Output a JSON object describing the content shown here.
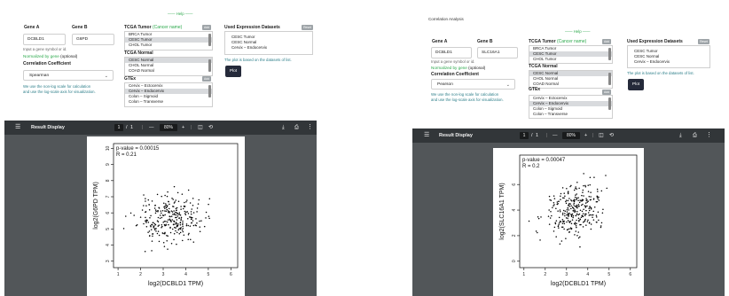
{
  "panels": [
    {
      "analysis_title": "",
      "help": "—— Help ——",
      "gene_a_label": "Gene A",
      "gene_b_label": "Gene B",
      "gene_a": "DCBLD1",
      "gene_b": "G6PD",
      "input_hint": "Input a gene symbol or id.",
      "norm_green": "Normalized by gene",
      "norm_rest": " (optional)",
      "coef_label": "Correlation Coefficient",
      "coef_value": "Spearman",
      "log_note_1": "We use the non-log scale for calculation",
      "log_note_2": "and use the log-scale axis for visualization.",
      "tumor_label": "TCGA Tumor",
      "tumor_green": " (Cancer name)",
      "tumor_items": [
        "BRCA Tumor",
        "CESC Tumor",
        "CHOL Tumor"
      ],
      "tumor_selected": [
        1
      ],
      "normal_label": "TCGA Normal",
      "normal_items": [
        "CESC Normal",
        "CHOL Normal",
        "COAD Normal"
      ],
      "normal_selected": [
        0
      ],
      "gtex_label": "GTEx",
      "gtex_items": [
        "Cervix – Ectocervix",
        "Cervix – Endocervix",
        "Colon – Sigmoid",
        "Colon – Transverse"
      ],
      "gtex_selected": [
        1
      ],
      "add_label": "Add",
      "used_label": "Used Expression Datasets",
      "reset_label": "Reset",
      "used_items": [
        "CESC Tumor",
        "CESC Normal",
        "Cervix – Endocervix"
      ],
      "used_note": "The plot is based on the datasets of list.",
      "plot_label": "Plot",
      "viewer": {
        "title": "Result Display",
        "page_current": "1",
        "page_sep": "/",
        "page_total": "1",
        "minus": "—",
        "zoom": "80%",
        "plus": "+"
      },
      "chart_data": {
        "type": "scatter",
        "xlabel": "log2(DCBLD1 TPM)",
        "ylabel": "log2(G6PD TPM)",
        "annotations": [
          "p-value = 0.00015",
          "R = 0.21"
        ],
        "xlim": [
          0.8,
          6.3
        ],
        "ylim": [
          2.6,
          10.3
        ],
        "xticks": [
          1,
          2,
          3,
          4,
          5,
          6
        ],
        "yticks": [
          3,
          4,
          5,
          6,
          7,
          8,
          9,
          10
        ],
        "center": [
          3.3,
          5.6
        ],
        "spread": [
          0.9,
          1.0
        ],
        "slope": 0.25,
        "n": 290,
        "seed": 11
      }
    },
    {
      "analysis_title": "Correlation Analysis",
      "help": "—— Help ——",
      "gene_a_label": "Gene A",
      "gene_b_label": "Gene B",
      "gene_a": "DCBLD1",
      "gene_b": "SLC16A1",
      "input_hint": "Input a gene symbol or id.",
      "norm_green": "Normalized by gene",
      "norm_rest": " (optional)",
      "coef_label": "Correlation Coefficient",
      "coef_value": "Pearson",
      "log_note_1": "We use the non-log scale for calculation",
      "log_note_2": "and use the log-scale axis for visualization.",
      "tumor_label": "TCGA Tumor",
      "tumor_green": " (Cancer name)",
      "tumor_items": [
        "BRCA Tumor",
        "CESC Tumor",
        "CHOL Tumor"
      ],
      "tumor_selected": [
        1
      ],
      "normal_label": "TCGA Normal",
      "normal_items": [
        "CESC Normal",
        "CHOL Normal",
        "COAD Normal"
      ],
      "normal_selected": [
        0
      ],
      "gtex_label": "GTEx",
      "gtex_items": [
        "Cervix – Ectocervix",
        "Cervix – Endocervix",
        "Colon – Sigmoid",
        "Colon – Transverse"
      ],
      "gtex_selected": [
        1
      ],
      "add_label": "Add",
      "used_label": "Used Expression Datasets",
      "reset_label": "Reset",
      "used_items": [
        "CESC Tumor",
        "CESC Normal",
        "Cervix – Endocervix"
      ],
      "used_note": "The plot is based on the datasets of list.",
      "plot_label": "Plot",
      "viewer": {
        "title": "Result Display",
        "page_current": "1",
        "page_sep": "/",
        "page_total": "1",
        "minus": "—",
        "zoom": "80%",
        "plus": "+"
      },
      "chart_data": {
        "type": "scatter",
        "xlabel": "log2(DCBLD1 TPM)",
        "ylabel": "log2(SLC16A1 TPM)",
        "annotations": [
          "p-value = 0.00047",
          "R = 0.2"
        ],
        "xlim": [
          0.8,
          6.3
        ],
        "ylim": [
          -0.5,
          8.3
        ],
        "xticks": [
          1,
          2,
          3,
          4,
          5,
          6
        ],
        "yticks": [
          0,
          2,
          4,
          6
        ],
        "center": [
          3.4,
          4.0
        ],
        "spread": [
          0.9,
          1.3
        ],
        "slope": 0.3,
        "n": 300,
        "seed": 29
      }
    }
  ]
}
